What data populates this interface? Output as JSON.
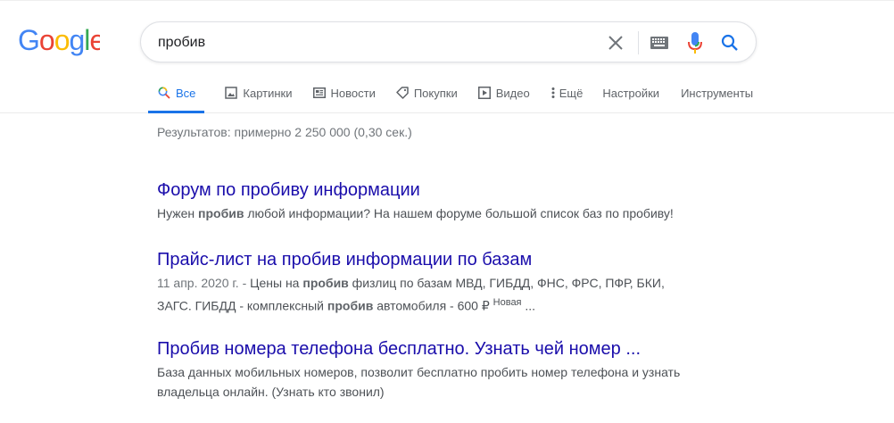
{
  "logo": {
    "text": "Google"
  },
  "search": {
    "query": "пробив",
    "placeholder": ""
  },
  "tabs": [
    {
      "label": "Все",
      "icon": "search-icon",
      "active": true
    },
    {
      "label": "Картинки",
      "icon": "image-icon"
    },
    {
      "label": "Новости",
      "icon": "news-icon"
    },
    {
      "label": "Покупки",
      "icon": "tag-icon"
    },
    {
      "label": "Видео",
      "icon": "play-icon"
    },
    {
      "label": "Ещё",
      "icon": "more-vertical-icon"
    },
    {
      "label": "Настройки"
    },
    {
      "label": "Инструменты"
    }
  ],
  "stats": "Результатов: примерно 2 250 000 (0,30 сек.)",
  "results": [
    {
      "title": "Форум по пробиву информации",
      "snippet_a": "Нужен ",
      "snippet_b": "пробив",
      "snippet_c": " любой информации? На нашем форуме большой список баз по пробиву!"
    },
    {
      "title": "Прайс-лист на пробив информации по базам",
      "date": "11 апр. 2020 г. - ",
      "snippet_a": "Цены на ",
      "snippet_b": "пробив",
      "snippet_c": " физлиц по базам МВД, ГИБДД, ФНС, ФРС, ПФР, БКИ,",
      "snippet_d": "ЗАГС. ГИБДД - комплексный ",
      "snippet_e": "пробив",
      "snippet_f": " автомобиля - 600 ₽ ",
      "badge": "Новая",
      "ellipsis": " ..."
    },
    {
      "title": "Пробив номера телефона бесплатно. Узнать чей номер ...",
      "snippet_line1": "База данных мобильных номеров, позволит бесплатно пробить номер телефона и узнать",
      "snippet_line2": "владельца онлайн. (Узнать кто звонил)"
    }
  ],
  "colors": {
    "link": "#1a0dab",
    "accent": "#1a73e8",
    "google_blue": "#4285f4",
    "google_red": "#ea4335",
    "google_yellow": "#fbbc05",
    "google_green": "#34a853"
  }
}
